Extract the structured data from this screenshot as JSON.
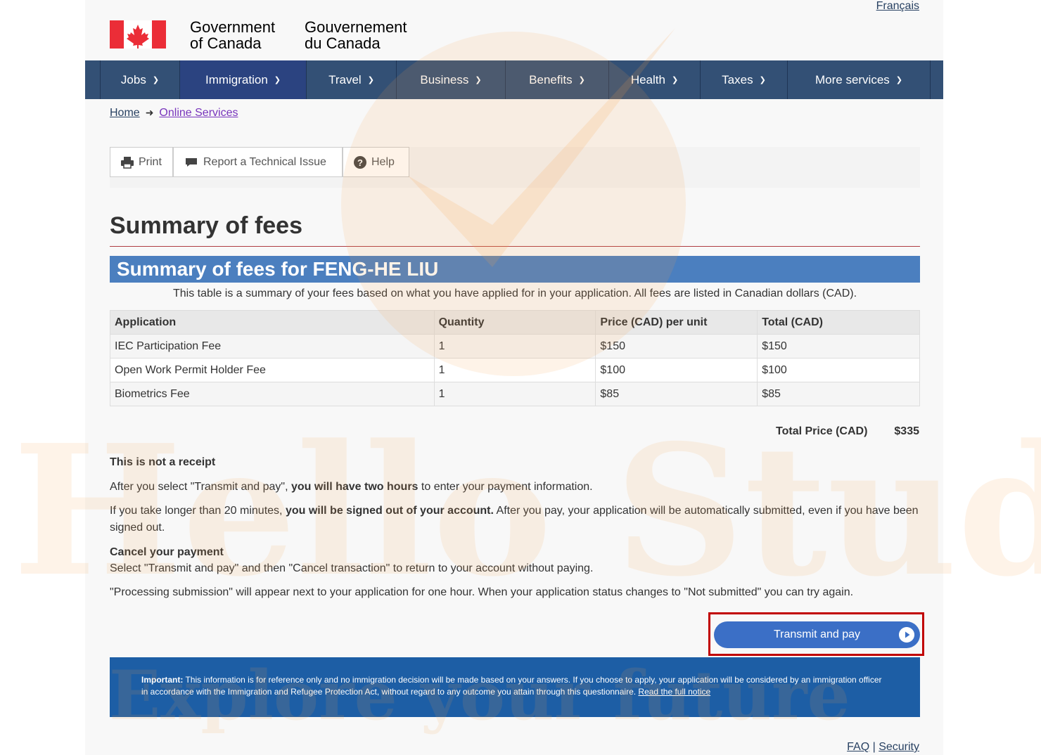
{
  "header": {
    "language_link": "Français",
    "signature_en_line1": "Government",
    "signature_en_line2": "of Canada",
    "signature_fr_line1": "Gouvernement",
    "signature_fr_line2": "du Canada"
  },
  "nav": {
    "items": [
      {
        "label": "Jobs",
        "active": false
      },
      {
        "label": "Immigration",
        "active": true
      },
      {
        "label": "Travel",
        "active": false
      },
      {
        "label": "Business",
        "active": false
      },
      {
        "label": "Benefits",
        "active": false
      },
      {
        "label": "Health",
        "active": false
      },
      {
        "label": "Taxes",
        "active": false
      },
      {
        "label": "More services",
        "active": false
      }
    ]
  },
  "breadcrumb": {
    "home": "Home",
    "current": "Online Services"
  },
  "toolbar": {
    "print": "Print",
    "report": "Report a Technical Issue",
    "help": "Help"
  },
  "page_title": "Summary of fees",
  "fees": {
    "caption": "Summary of fees for FENG-HE LIU",
    "description": "This table is a summary of your fees based on what you have applied for in your application. All fees are listed in Canadian dollars (CAD).",
    "headers": [
      "Application",
      "Quantity",
      "Price (CAD) per unit",
      "Total (CAD)"
    ],
    "rows": [
      [
        "IEC Participation Fee",
        "1",
        "$150",
        "$150"
      ],
      [
        "Open Work Permit Holder Fee",
        "1",
        "$100",
        "$100"
      ],
      [
        "Biometrics Fee",
        "1",
        "$85",
        "$85"
      ]
    ],
    "total_label": "Total Price (CAD)",
    "total_value": "$335"
  },
  "info": {
    "receipt_heading": "This is not a receipt",
    "p1_a": "After you select \"Transmit and pay\", ",
    "p1_b": "you will have two hours",
    "p1_c": " to enter your payment information.",
    "p2_a": "If you take longer than 20 minutes, ",
    "p2_b": "you will be signed out of your account.",
    "p2_c": " After you pay, your application will be automatically submitted, even if you have been signed out.",
    "cancel_heading": "Cancel your payment",
    "p3": "Select \"Transmit and pay\" and then \"Cancel transaction\" to return to your account without paying.",
    "p4": "\"Processing submission\" will appear next to your application for one hour. When your application status changes to \"Not submitted\" you can try again."
  },
  "transmit_button": "Transmit and pay",
  "notice": {
    "label": "Important:",
    "text": " This information is for reference only and no immigration decision will be made based on your answers. If you choose to apply, your application will be considered by an immigration officer in accordance with the Immigration and Refugee Protection Act, without regard to any outcome you attain through this questionnaire. ",
    "link": "Read the full notice"
  },
  "footer": {
    "faq": "FAQ",
    "separator": "|",
    "security": "Security"
  },
  "watermark": {
    "line1": "Hello Study",
    "line2": "Explore your future"
  },
  "colors": {
    "nav": "#335075",
    "caption": "#4b7fbf",
    "notice": "#1d5ea5",
    "button": "#3b6fc6",
    "highlight": "#c10000"
  }
}
